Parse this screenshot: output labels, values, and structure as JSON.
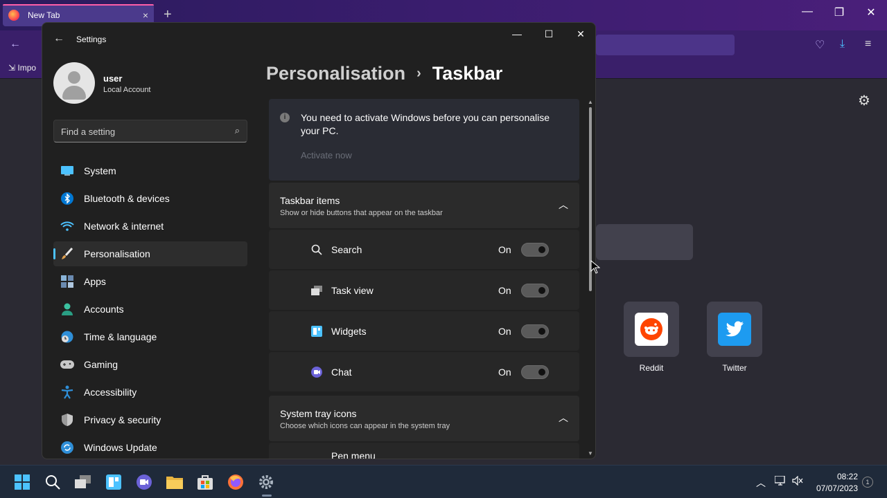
{
  "browser": {
    "tab_title": "New Tab",
    "tab_close": "×",
    "new_tab": "+",
    "window_controls": {
      "minimize": "—",
      "restore": "❐",
      "close": "✕"
    },
    "bookmark_import": "Impo",
    "shortcuts": [
      {
        "label": "Reddit",
        "icon": "reddit-icon",
        "color": "#ff4500"
      },
      {
        "label": "Twitter",
        "icon": "twitter-icon",
        "color": "#1d9bf0"
      }
    ]
  },
  "settings": {
    "window_title": "Settings",
    "window_controls": {
      "minimize": "—",
      "maximize": "☐",
      "close": "✕"
    },
    "profile": {
      "name": "user",
      "account_type": "Local Account"
    },
    "search": {
      "placeholder": "Find a setting"
    },
    "nav": [
      {
        "label": "System",
        "icon": "system-icon",
        "active": false
      },
      {
        "label": "Bluetooth & devices",
        "icon": "bluetooth-icon",
        "active": false
      },
      {
        "label": "Network & internet",
        "icon": "wifi-icon",
        "active": false
      },
      {
        "label": "Personalisation",
        "icon": "brush-icon",
        "active": true
      },
      {
        "label": "Apps",
        "icon": "apps-icon",
        "active": false
      },
      {
        "label": "Accounts",
        "icon": "accounts-icon",
        "active": false
      },
      {
        "label": "Time & language",
        "icon": "globe-clock-icon",
        "active": false
      },
      {
        "label": "Gaming",
        "icon": "gamepad-icon",
        "active": false
      },
      {
        "label": "Accessibility",
        "icon": "accessibility-icon",
        "active": false
      },
      {
        "label": "Privacy & security",
        "icon": "shield-icon",
        "active": false
      },
      {
        "label": "Windows Update",
        "icon": "update-icon",
        "active": false
      }
    ],
    "breadcrumb": {
      "parent": "Personalisation",
      "separator": "›",
      "current": "Taskbar"
    },
    "activation": {
      "message": "You need to activate Windows before you can personalise your PC.",
      "link": "Activate now"
    },
    "sections": [
      {
        "title": "Taskbar items",
        "description": "Show or hide buttons that appear on the taskbar",
        "chevron": "︿",
        "items": [
          {
            "label": "Search",
            "state": "On",
            "icon": "search-icon"
          },
          {
            "label": "Task view",
            "state": "On",
            "icon": "task-view-icon"
          },
          {
            "label": "Widgets",
            "state": "On",
            "icon": "widgets-icon"
          },
          {
            "label": "Chat",
            "state": "On",
            "icon": "chat-icon"
          }
        ]
      },
      {
        "title": "System tray icons",
        "description": "Choose which icons can appear in the system tray",
        "chevron": "︿",
        "items": [
          {
            "label": "Pen menu"
          }
        ]
      }
    ]
  },
  "taskbar": {
    "time": "08:22",
    "date": "07/07/2023",
    "notification_count": "1",
    "apps": [
      "start-icon",
      "search-icon",
      "task-view-icon",
      "widgets-icon",
      "chat-icon",
      "file-explorer-icon",
      "store-icon",
      "firefox-icon",
      "settings-icon"
    ]
  }
}
